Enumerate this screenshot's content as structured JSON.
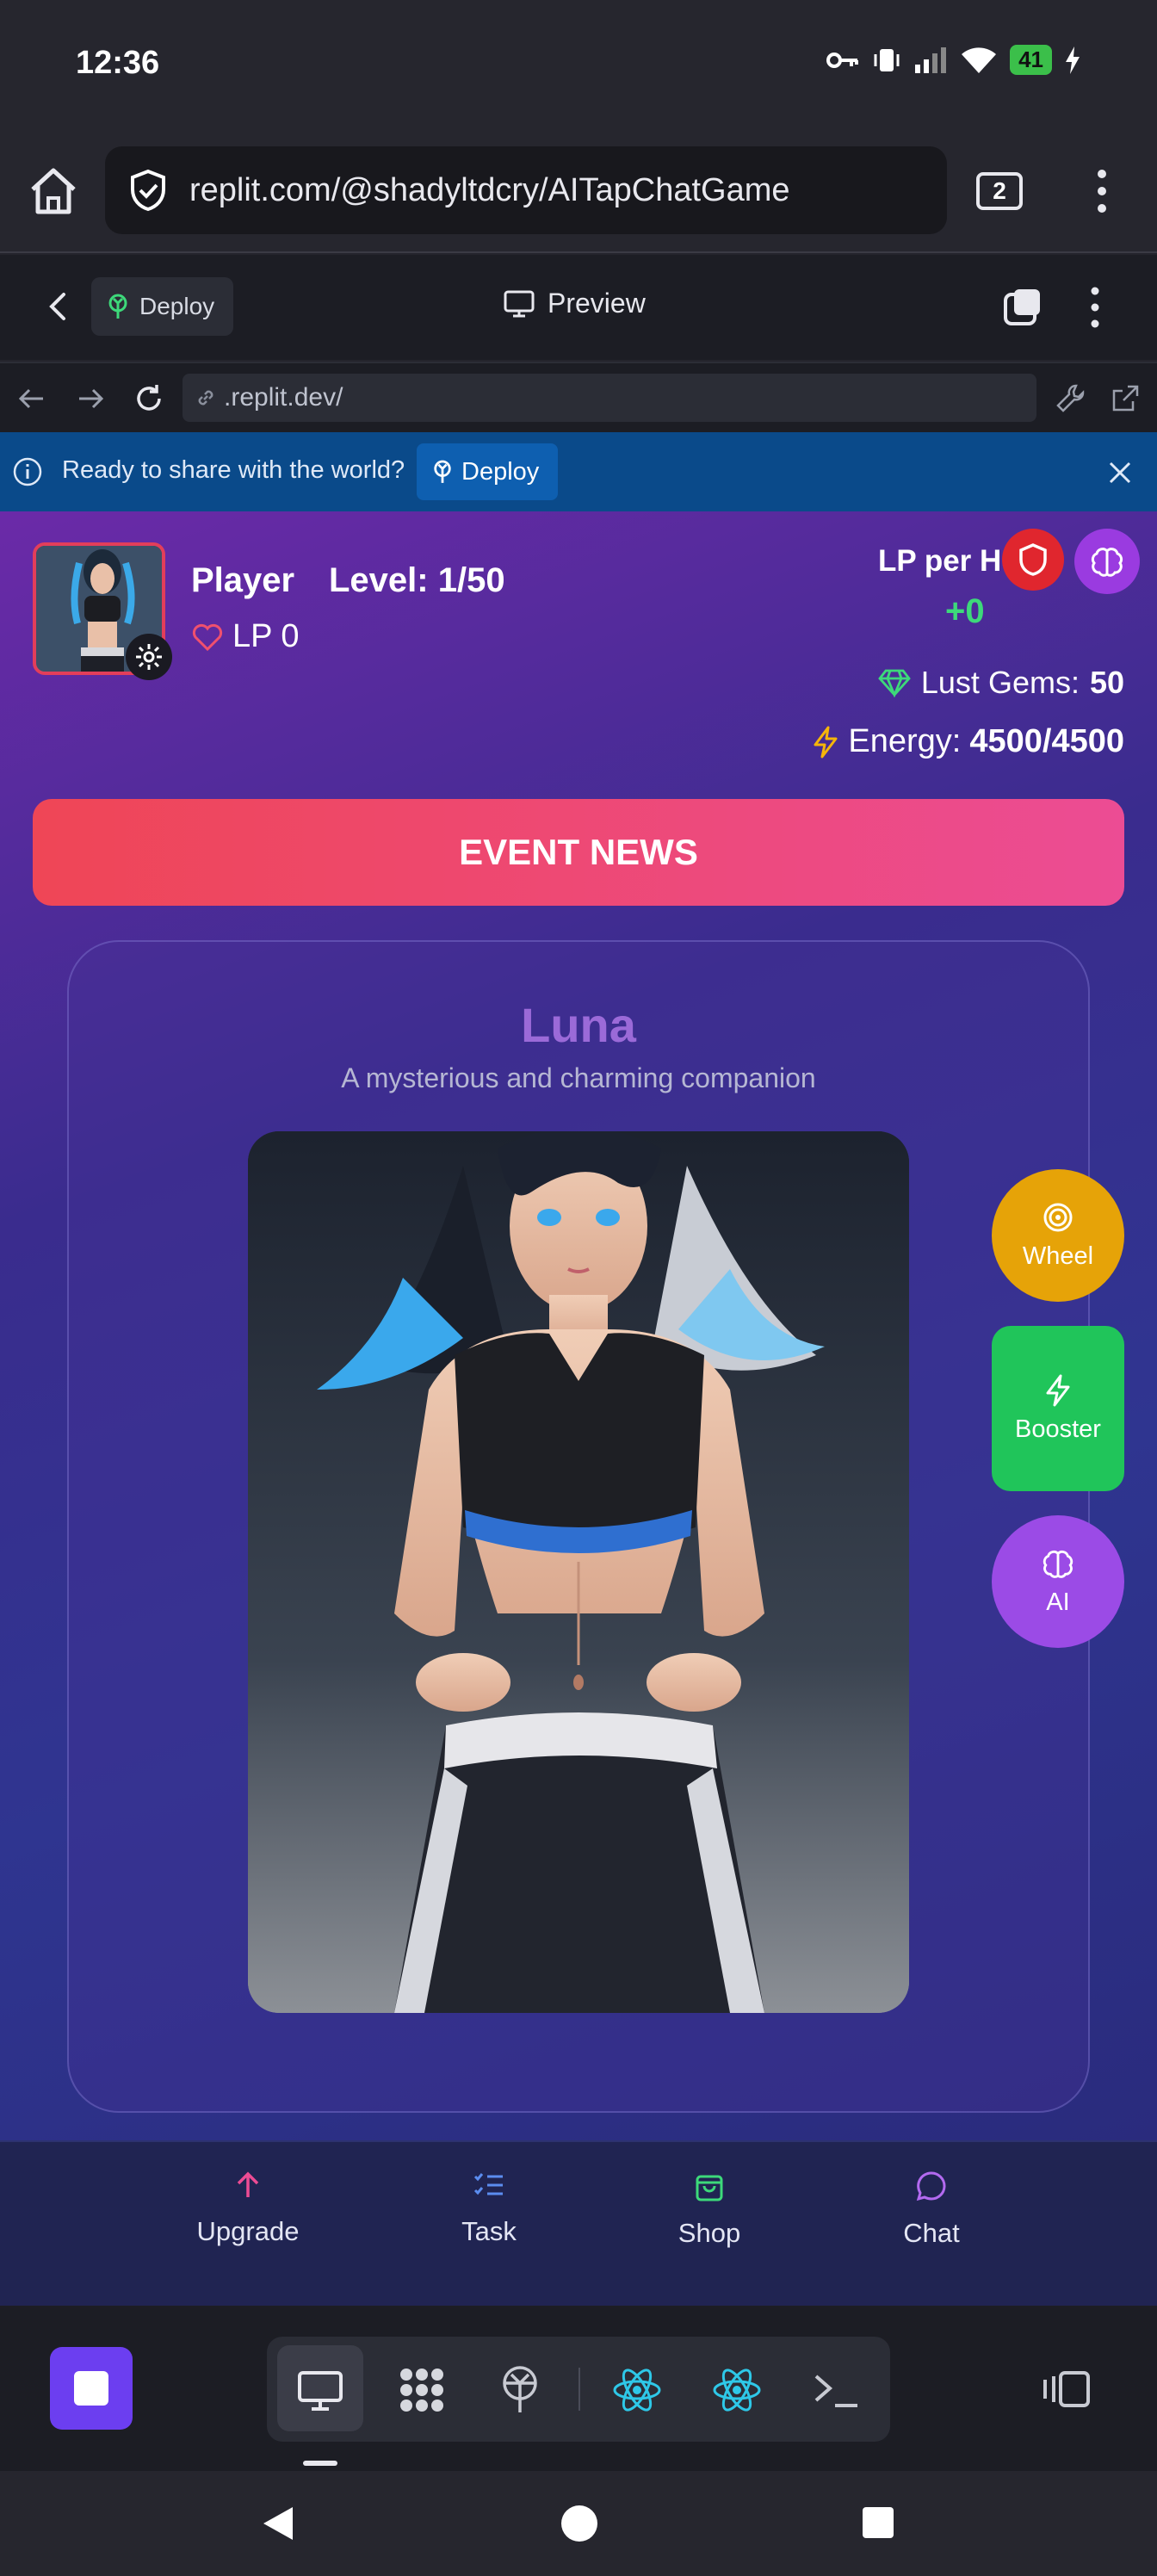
{
  "status": {
    "time": "12:36",
    "battery": "41"
  },
  "browser": {
    "url": "replit.com/@shadyltdcry/AITapChatGame",
    "tab_count": "2"
  },
  "replit": {
    "deploy_label": "Deploy",
    "preview_label": "Preview",
    "address": ".replit.dev/"
  },
  "banner": {
    "text": "Ready to share with the world?",
    "deploy_label": "Deploy"
  },
  "game": {
    "player_label": "Player",
    "level_label": "Level: 1/50",
    "lp_label": "LP 0",
    "lp_per_hour_label": "LP per Ho",
    "lp_per_hour_value": "+0",
    "gems_label": "Lust Gems:",
    "gems_value": "50",
    "energy_label": "Energy:",
    "energy_value": "4500/4500",
    "event_button": "EVENT NEWS",
    "character": {
      "name": "Luna",
      "description": "A mysterious and charming companion"
    },
    "side_buttons": {
      "wheel": "Wheel",
      "booster": "Booster",
      "ai": "AI"
    },
    "tabs": [
      {
        "label": "Upgrade",
        "icon": "arrow-up-icon",
        "color": "#ec4c94"
      },
      {
        "label": "Task",
        "icon": "checklist-icon",
        "color": "#5b8df0"
      },
      {
        "label": "Shop",
        "icon": "shopping-bag-icon",
        "color": "#3dd97a"
      },
      {
        "label": "Chat",
        "icon": "chat-bubble-icon",
        "color": "#b36af0"
      }
    ]
  },
  "colors": {
    "accent_purple": "#6c3ef0",
    "event_start": "#ef4656",
    "event_end": "#ec4c94",
    "lph_green": "#3dd97a"
  }
}
